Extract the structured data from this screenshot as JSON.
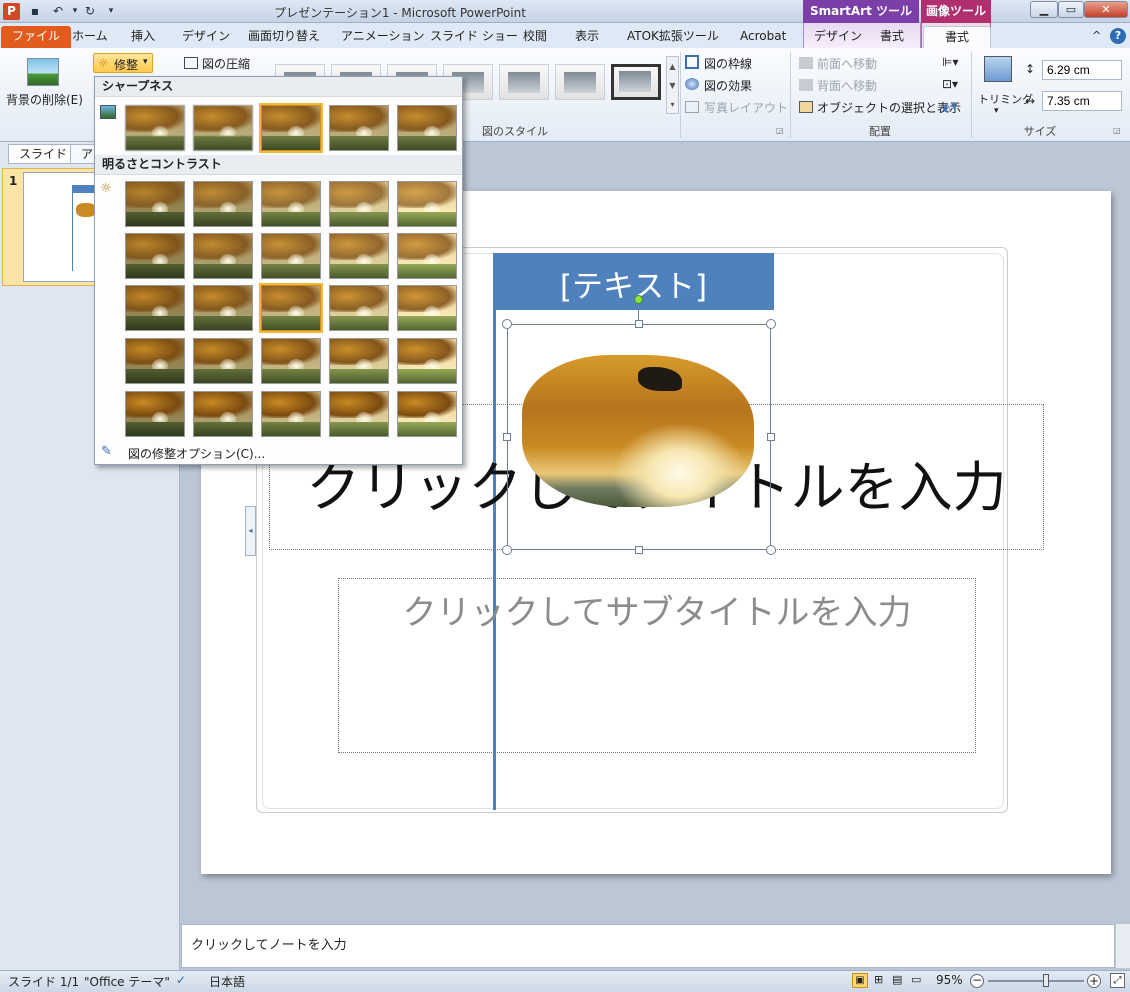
{
  "window": {
    "title": "プレゼンテーション1 - Microsoft PowerPoint",
    "ctx_smartart": "SmartArt ツール",
    "ctx_image": "画像ツール",
    "minimize": "▁",
    "maximize": "▭",
    "close": "✕"
  },
  "tabs": {
    "file": "ファイル",
    "home": "ホーム",
    "insert": "挿入",
    "design": "デザイン",
    "transitions": "画面切り替え",
    "animations": "アニメーション",
    "slideshow": "スライド ショー",
    "review": "校閲",
    "view": "表示",
    "atok": "ATOK拡張ツール",
    "acrobat": "Acrobat",
    "sa_design": "デザイン",
    "sa_format": "書式",
    "img_format": "書式"
  },
  "ribbon": {
    "remove_bg": "背景の削除(E)",
    "corrections": "修整",
    "compress": "図の圧縮",
    "border": "図の枠線",
    "effects": "図の効果",
    "layout": "写真レイアウト",
    "styles_group": "図のスタイル",
    "bring_forward": "前面へ移動",
    "send_backward": "背面へ移動",
    "selection_pane": "オブジェクトの選択と表示",
    "arrange_group": "配置",
    "crop": "トリミング",
    "height": "6.29 cm",
    "width": "7.35 cm",
    "size_group": "サイズ"
  },
  "gallery": {
    "sharpness_header": "シャープネス",
    "brightness_header": "明るさとコントラスト",
    "options": "図の修整オプション(C)..."
  },
  "leftpane": {
    "tab_slides": "スライド",
    "tab_outline": "ア",
    "slide_number": "1"
  },
  "slide": {
    "smartart_text": "[テキスト]",
    "title_placeholder": "クリックしてタイトルを入力",
    "subtitle_placeholder": "クリックしてサブタイトルを入力"
  },
  "notes": {
    "placeholder": "クリックしてノートを入力"
  },
  "status": {
    "slide": "スライド 1/1",
    "theme": "\"Office テーマ\"",
    "language": "日本語",
    "zoom": "95%",
    "zoom_level": 0.6
  },
  "colors": {
    "file_tab": "#e25a1c",
    "smartart_ctx": "#7c3fa8",
    "image_ctx": "#b0306f",
    "smartart_header": "#4f81bd",
    "selection": "#f2b73c"
  }
}
